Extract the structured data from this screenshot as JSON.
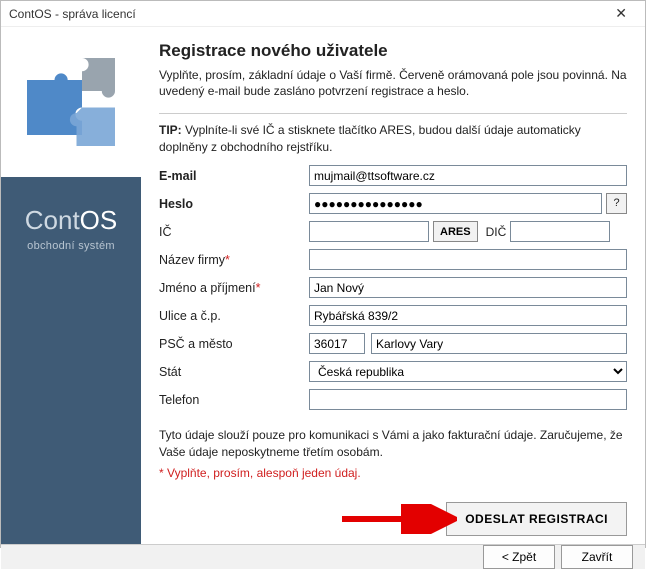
{
  "window": {
    "title": "ContOS - správa licencí"
  },
  "sidebar": {
    "brand_cont": "Cont",
    "brand_os": "OS",
    "subtitle": "obchodní systém"
  },
  "header": {
    "title": "Registrace nového uživatele",
    "intro": "Vyplňte, prosím, základní údaje o Vaší firmě. Červeně orámovaná pole jsou povinná. Na uvedený e-mail bude zasláno potvrzení registrace a heslo.",
    "tip_prefix": "TIP:",
    "tip_text": "Vyplníte-li své IČ a stisknete tlačítko ARES, budou další údaje automaticky doplněny z obchodního rejstříku."
  },
  "form": {
    "email": {
      "label": "E-mail",
      "value": "mujmail@ttsoftware.cz"
    },
    "password": {
      "label": "Heslo",
      "value": "●●●●●●●●●●●●●●●",
      "help": "?"
    },
    "ic": {
      "label": "IČ",
      "value": "",
      "ares_btn": "ARES",
      "dic_label": "DIČ",
      "dic_value": ""
    },
    "company": {
      "label": "Název firmy",
      "value": ""
    },
    "name": {
      "label": "Jméno a příjmení",
      "value": "Jan Nový"
    },
    "street": {
      "label": "Ulice a č.p.",
      "value": "Rybářská 839/2"
    },
    "zipcity": {
      "label": "PSČ a město",
      "zip": "36017",
      "city": "Karlovy Vary"
    },
    "country": {
      "label": "Stát",
      "value": "Česká republika"
    },
    "phone": {
      "label": "Telefon",
      "value": ""
    }
  },
  "notes": {
    "privacy": "Tyto údaje slouží pouze pro komunikaci s Vámi a jako fakturační údaje. Zaručujeme, že Vaše údaje neposkytneme třetím osobám.",
    "required_hint": "* Vyplňte, prosím, alespoň jeden údaj."
  },
  "buttons": {
    "submit": "ODESLAT REGISTRACI",
    "back": "< Zpět",
    "close": "Zavřít"
  }
}
